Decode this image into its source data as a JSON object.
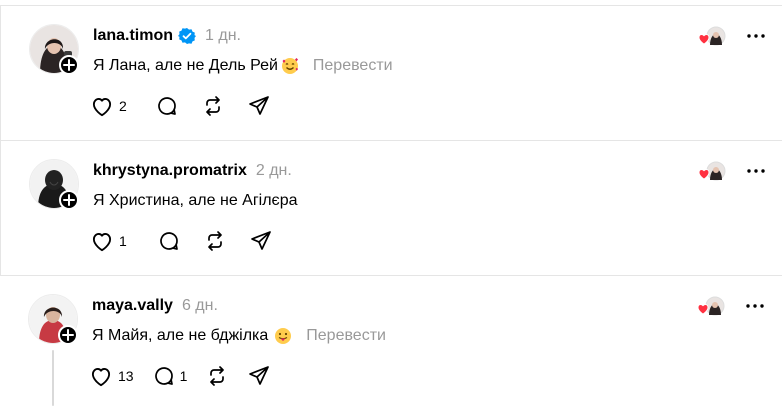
{
  "posts": [
    {
      "username": "lana.timon",
      "verified": true,
      "time": "1 дн.",
      "text": "Я Лана, але не Дель Рей",
      "emoji": "smiling-face-with-hearts",
      "translate": "Перевести",
      "likes": "2",
      "replies": ""
    },
    {
      "username": "khrystyna.promatrix",
      "verified": false,
      "time": "2 дн.",
      "text": "Я Христина, але не Агілєра",
      "emoji": "",
      "translate": "",
      "likes": "1",
      "replies": ""
    },
    {
      "username": "maya.vally",
      "verified": false,
      "time": "6 дн.",
      "text": "Я Майя, але не бджілка",
      "emoji": "face-with-tongue",
      "translate": "Перевести",
      "likes": "13",
      "replies": "1"
    }
  ],
  "colors": {
    "accent": "#0095f6",
    "muted": "#999999",
    "like_heart": "#ff3040",
    "divider": "#e5e5e5"
  },
  "icons": [
    "plus-icon",
    "verified-badge-icon",
    "heart-icon",
    "comment-icon",
    "repost-icon",
    "share-icon",
    "more-icon",
    "liked-by-author-icon"
  ]
}
